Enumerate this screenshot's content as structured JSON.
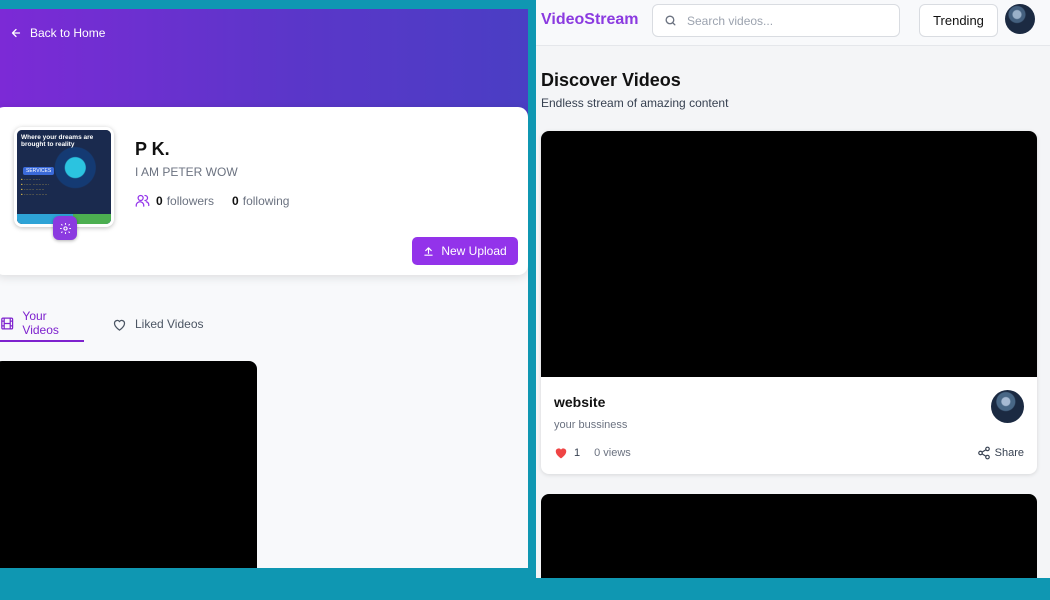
{
  "left": {
    "back_label": "Back to Home",
    "profile": {
      "name": "P K.",
      "bio": "I AM PETER WOW",
      "followers_count": "0",
      "followers_label": "followers",
      "following_count": "0",
      "following_label": "following",
      "avatar_text": "Where your dreams are brought to reality",
      "avatar_services": "SERVICES"
    },
    "upload_label": "New Upload",
    "tabs": [
      {
        "label": "Your Videos",
        "icon": "film-icon",
        "active": true
      },
      {
        "label": "Liked Videos",
        "icon": "heart-icon",
        "active": false
      }
    ]
  },
  "right": {
    "brand": "VideoStream",
    "search_placeholder": "Search videos...",
    "trending_label": "Trending",
    "heading": "Discover Videos",
    "subheading": "Endless stream of amazing content",
    "videos": [
      {
        "title": "website",
        "description": "your bussiness",
        "likes": "1",
        "views": "0 views",
        "share_label": "Share"
      }
    ]
  },
  "colors": {
    "accent": "#9333ea",
    "background": "#0f97b2",
    "hero_start": "#7c2ad6",
    "hero_end": "#4a3ec4",
    "like": "#ef4444"
  }
}
